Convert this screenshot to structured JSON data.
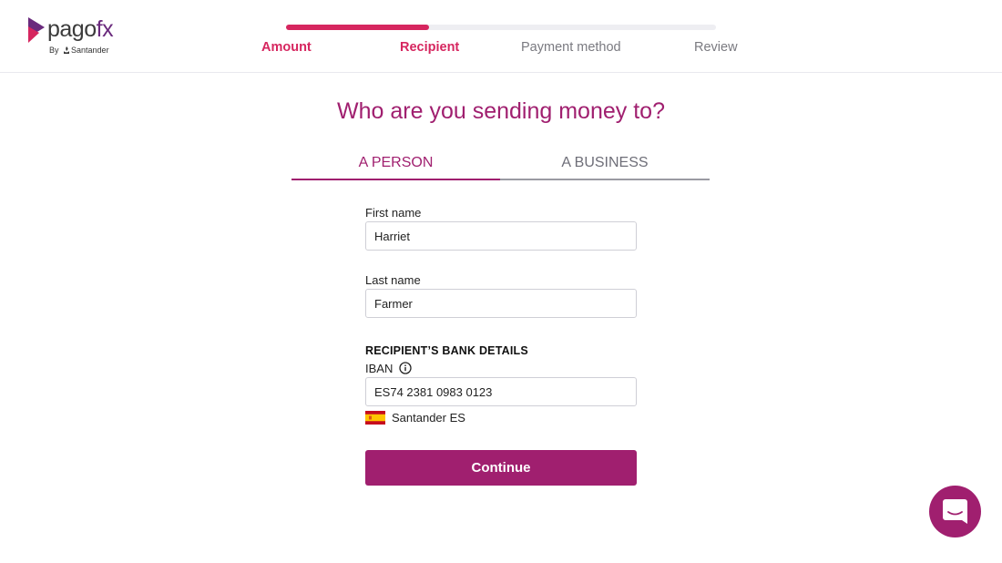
{
  "brand": {
    "name_prefix": "pago",
    "name_suffix": "fx",
    "by_text": "By",
    "partner": "Santander",
    "color": "#a01f6f"
  },
  "steps": [
    {
      "label": "Amount",
      "state": "done"
    },
    {
      "label": "Recipient",
      "state": "current"
    },
    {
      "label": "Payment method",
      "state": "todo"
    },
    {
      "label": "Review",
      "state": "todo"
    }
  ],
  "progress": {
    "fraction": 0.333,
    "color": "#d6265f"
  },
  "page_title": "Who are you sending money to?",
  "tabs": [
    {
      "label": "A PERSON",
      "selected": true
    },
    {
      "label": "A BUSINESS",
      "selected": false
    }
  ],
  "form": {
    "first_name": {
      "label": "First name",
      "value": "Harriet"
    },
    "last_name": {
      "label": "Last name",
      "value": "Farmer"
    },
    "bank_section_title": "RECIPIENT’S BANK DETAILS",
    "iban": {
      "label": "IBAN",
      "value": "ES74 2381 0983 0123",
      "info_icon": "info-icon"
    },
    "bank": {
      "name": "Santander ES",
      "flag": "spain-flag"
    }
  },
  "continue_label": "Continue",
  "chat_icon": "chat-bubble-icon"
}
